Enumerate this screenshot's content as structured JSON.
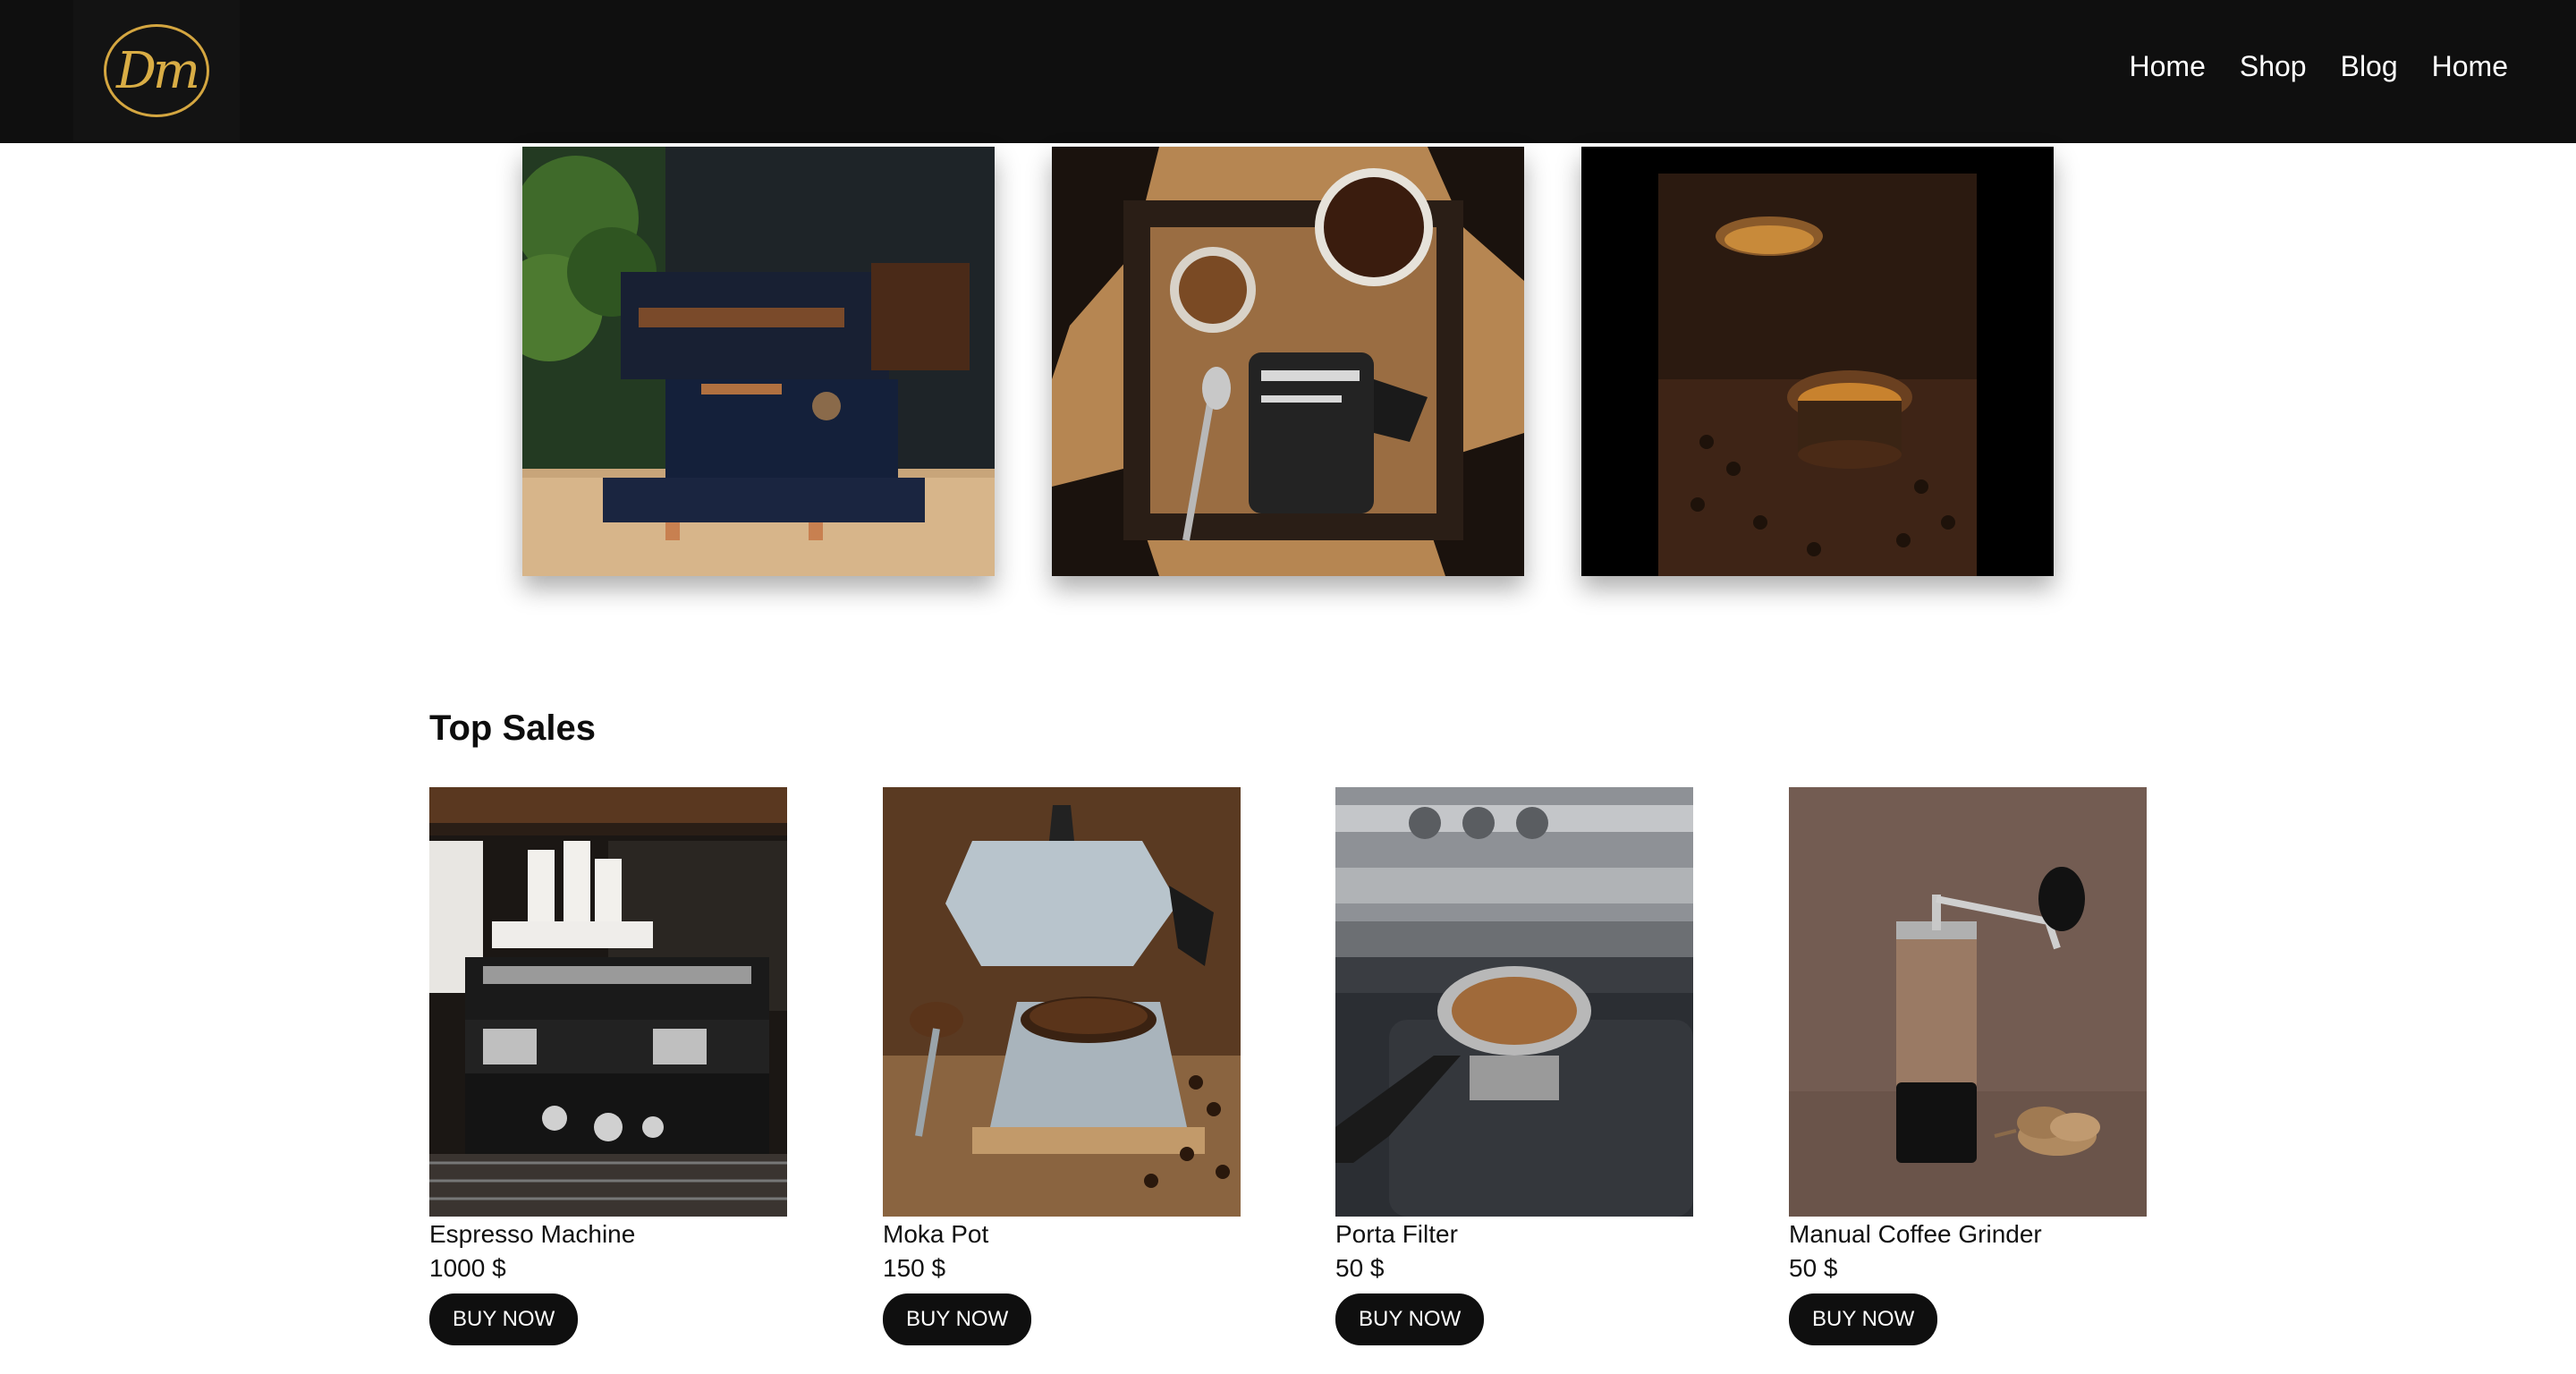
{
  "header": {
    "logo_text": "Dm",
    "nav": [
      {
        "label": "Home"
      },
      {
        "label": "Shop"
      },
      {
        "label": "Blog"
      },
      {
        "label": "Home"
      }
    ]
  },
  "hero_images": [
    {
      "icon": "espresso-machine-photo"
    },
    {
      "icon": "moka-pot-flatlay-photo"
    },
    {
      "icon": "coffee-beans-cup-photo"
    }
  ],
  "top_sales": {
    "title": "Top Sales",
    "products": [
      {
        "name": "Espresso Machine",
        "price": "1000 $",
        "button": "BUY NOW"
      },
      {
        "name": "Moka Pot",
        "price": "150 $",
        "button": "BUY NOW"
      },
      {
        "name": "Porta Filter",
        "price": "50 $",
        "button": "BUY NOW"
      },
      {
        "name": "Manual Coffee Grinder",
        "price": "50 $",
        "button": "BUY NOW"
      }
    ]
  },
  "colors": {
    "header_bg": "#0f0f0f",
    "logo_gold": "#d4a640",
    "button_bg": "#0f0f0f",
    "button_text": "#ffffff"
  }
}
